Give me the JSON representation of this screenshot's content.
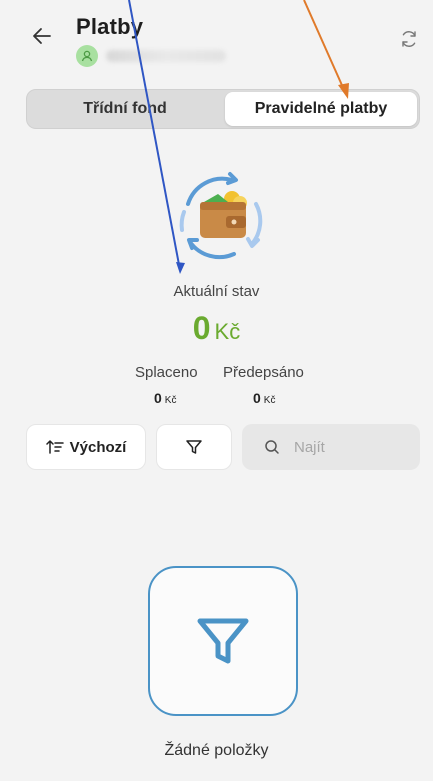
{
  "header": {
    "title": "Platby",
    "back_icon": "arrow-left-icon",
    "refresh_icon": "refresh-icon"
  },
  "tabs": [
    {
      "label": "Třídní fond",
      "active": false
    },
    {
      "label": "Pravidelné platby",
      "active": true
    }
  ],
  "status": {
    "label": "Aktuální stav",
    "amount": "0",
    "currency": "Kč"
  },
  "summary": {
    "paid_label": "Splaceno",
    "paid_value": "0",
    "paid_currency": "Kč",
    "prescribed_label": "Předepsáno",
    "prescribed_value": "0",
    "prescribed_currency": "Kč"
  },
  "toolbar": {
    "sort_label": "Výchozí",
    "search_placeholder": "Najít"
  },
  "empty": {
    "label": "Žádné položky"
  },
  "colors": {
    "accent_green": "#6aaa2f",
    "accent_blue": "#4a93c6",
    "annotation_blue": "#2f56c4",
    "annotation_orange": "#e07a2a"
  }
}
